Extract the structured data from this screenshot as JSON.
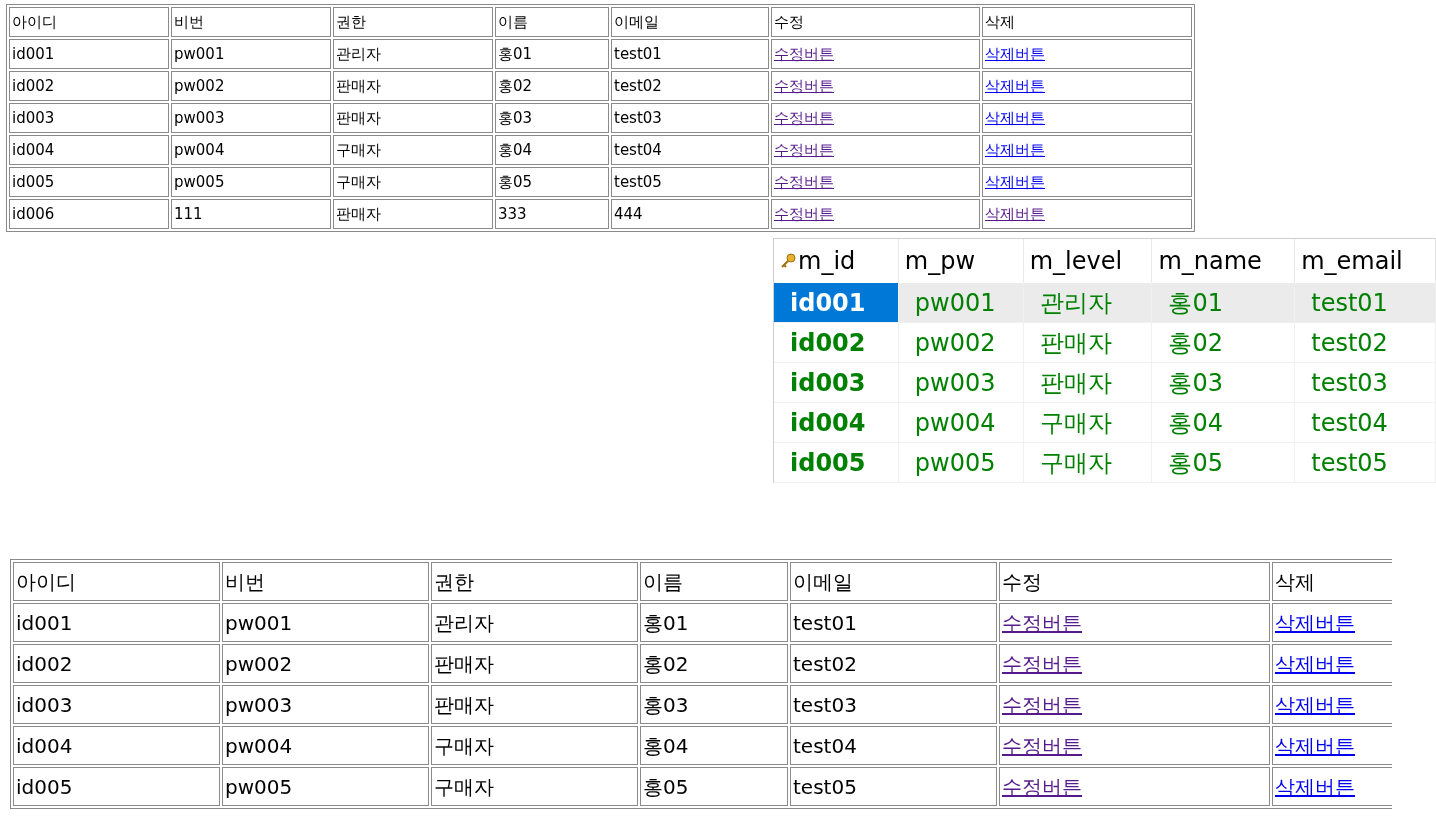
{
  "member_table": {
    "columns": [
      "아이디",
      "비번",
      "권한",
      "이름",
      "이메일",
      "수정",
      "삭제"
    ],
    "rows": [
      {
        "cells": [
          "id001",
          "pw001",
          "관리자",
          "홍01",
          "test01"
        ],
        "edit_link": {
          "text": "수정버튼",
          "visited": true
        },
        "delete_link": {
          "text": "삭제버튼",
          "visited": false
        }
      },
      {
        "cells": [
          "id002",
          "pw002",
          "판매자",
          "홍02",
          "test02"
        ],
        "edit_link": {
          "text": "수정버튼",
          "visited": true
        },
        "delete_link": {
          "text": "삭제버튼",
          "visited": false
        }
      },
      {
        "cells": [
          "id003",
          "pw003",
          "판매자",
          "홍03",
          "test03"
        ],
        "edit_link": {
          "text": "수정버튼",
          "visited": true
        },
        "delete_link": {
          "text": "삭제버튼",
          "visited": false
        }
      },
      {
        "cells": [
          "id004",
          "pw004",
          "구매자",
          "홍04",
          "test04"
        ],
        "edit_link": {
          "text": "수정버튼",
          "visited": true
        },
        "delete_link": {
          "text": "삭제버튼",
          "visited": false
        }
      },
      {
        "cells": [
          "id005",
          "pw005",
          "구매자",
          "홍05",
          "test05"
        ],
        "edit_link": {
          "text": "수정버튼",
          "visited": true
        },
        "delete_link": {
          "text": "삭제버튼",
          "visited": false
        }
      },
      {
        "cells": [
          "id006",
          "111",
          "판매자",
          "333",
          "444"
        ],
        "edit_link": {
          "text": "수정버튼",
          "visited": true
        },
        "delete_link": {
          "text": "삭제버튼",
          "visited": true
        }
      }
    ]
  },
  "db_grid": {
    "columns": [
      "m_id",
      "m_pw",
      "m_level",
      "m_name",
      "m_email"
    ],
    "rows": [
      {
        "selected": true,
        "cells": [
          "id001",
          "pw001",
          "관리자",
          "홍01",
          "test01"
        ]
      },
      {
        "selected": false,
        "cells": [
          "id002",
          "pw002",
          "판매자",
          "홍02",
          "test02"
        ]
      },
      {
        "selected": false,
        "cells": [
          "id003",
          "pw003",
          "판매자",
          "홍03",
          "test03"
        ]
      },
      {
        "selected": false,
        "cells": [
          "id004",
          "pw004",
          "구매자",
          "홍04",
          "test04"
        ]
      },
      {
        "selected": false,
        "cells": [
          "id005",
          "pw005",
          "구매자",
          "홍05",
          "test05"
        ]
      }
    ]
  },
  "db_member_table": {
    "columns": [
      "아이디",
      "비번",
      "권한",
      "이름",
      "이메일",
      "수정",
      "삭제"
    ],
    "rows": [
      {
        "cells": [
          "id001",
          "pw001",
          "관리자",
          "홍01",
          "test01"
        ],
        "edit_link": {
          "text": "수정버튼",
          "visited": true
        },
        "delete_link": {
          "text": "삭제버튼",
          "visited": false
        }
      },
      {
        "cells": [
          "id002",
          "pw002",
          "판매자",
          "홍02",
          "test02"
        ],
        "edit_link": {
          "text": "수정버튼",
          "visited": true
        },
        "delete_link": {
          "text": "삭제버튼",
          "visited": false
        }
      },
      {
        "cells": [
          "id003",
          "pw003",
          "판매자",
          "홍03",
          "test03"
        ],
        "edit_link": {
          "text": "수정버튼",
          "visited": true
        },
        "delete_link": {
          "text": "삭제버튼",
          "visited": false
        }
      },
      {
        "cells": [
          "id004",
          "pw004",
          "구매자",
          "홍04",
          "test04"
        ],
        "edit_link": {
          "text": "수정버튼",
          "visited": true
        },
        "delete_link": {
          "text": "삭제버튼",
          "visited": false
        }
      },
      {
        "cells": [
          "id005",
          "pw005",
          "구매자",
          "홍05",
          "test05"
        ],
        "edit_link": {
          "text": "수정버튼",
          "visited": true
        },
        "delete_link": {
          "text": "삭제버튼",
          "visited": false
        }
      }
    ]
  }
}
